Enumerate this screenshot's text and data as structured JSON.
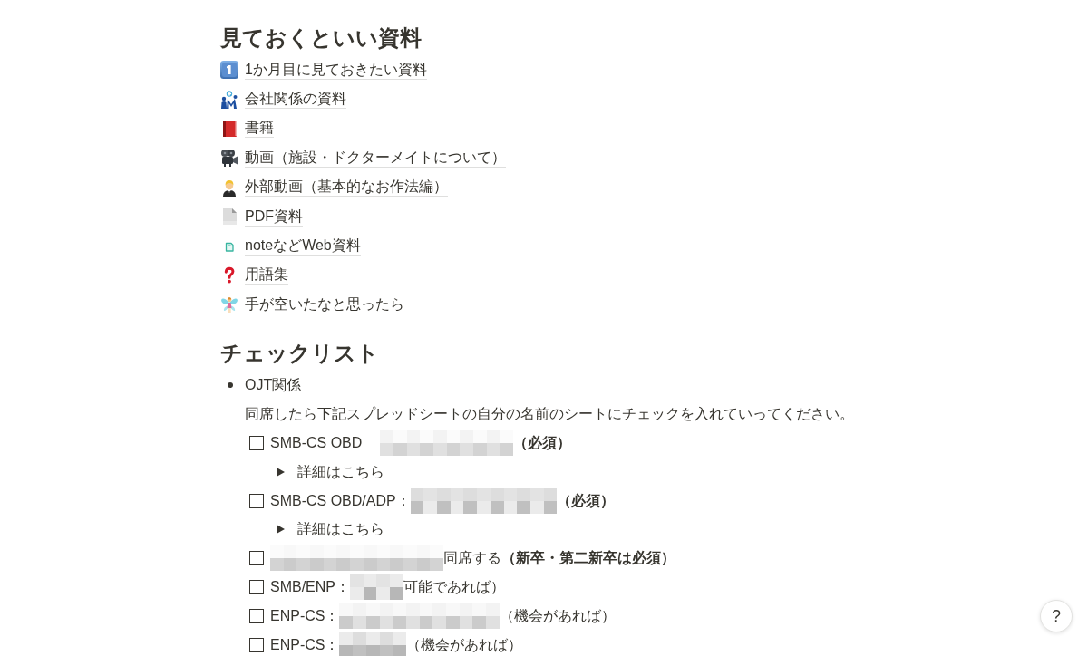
{
  "resources": {
    "heading": "見ておくといい資料",
    "pages": [
      {
        "label": "1か月目に見ておきたい資料"
      },
      {
        "label": "会社関係の資料"
      },
      {
        "label": "書籍"
      },
      {
        "label": "動画（施設・ドクターメイトについて）"
      },
      {
        "label": "外部動画（基本的なお作法編）"
      },
      {
        "label": "PDF資料"
      },
      {
        "label": "noteなどWeb資料"
      },
      {
        "label": "用語集"
      },
      {
        "label": "手が空いたなと思ったら"
      }
    ]
  },
  "checklist": {
    "heading": "チェックリスト",
    "items": [
      {
        "label": "OJT関係",
        "note": "同席したら下記スプレッドシートの自分の名前のシートにチェックを入れていってください。",
        "tasks": [
          {
            "checked": false,
            "parts": [
              {
                "kind": "text",
                "text": "SMB-CS OBD"
              },
              {
                "kind": "redacted"
              },
              {
                "kind": "bold",
                "text": "（必須）"
              }
            ],
            "toggle": {
              "label": "詳細はこちら",
              "expanded": false
            }
          },
          {
            "checked": false,
            "parts": [
              {
                "kind": "text",
                "text": "SMB-CS OBD/ADP："
              },
              {
                "kind": "redacted"
              },
              {
                "kind": "bold",
                "text": "（必須）"
              }
            ],
            "toggle": {
              "label": "詳細はこちら",
              "expanded": false
            }
          },
          {
            "checked": false,
            "parts": [
              {
                "kind": "redacted"
              },
              {
                "kind": "text",
                "text": "同席する"
              },
              {
                "kind": "bold",
                "text": "（新卒・第二新卒は必須）"
              }
            ]
          },
          {
            "checked": false,
            "parts": [
              {
                "kind": "text",
                "text": "SMB/ENP："
              },
              {
                "kind": "redacted"
              },
              {
                "kind": "text",
                "text": "可能であれば）"
              }
            ]
          },
          {
            "checked": false,
            "parts": [
              {
                "kind": "text",
                "text": "ENP-CS："
              },
              {
                "kind": "redacted"
              },
              {
                "kind": "text",
                "text": "（機会があれば）"
              }
            ]
          },
          {
            "checked": false,
            "parts": [
              {
                "kind": "text",
                "text": "ENP-CS："
              },
              {
                "kind": "redacted"
              },
              {
                "kind": "text",
                "text": "（機会があれば）"
              }
            ]
          }
        ]
      }
    ]
  },
  "help_button": {
    "label": "?"
  }
}
